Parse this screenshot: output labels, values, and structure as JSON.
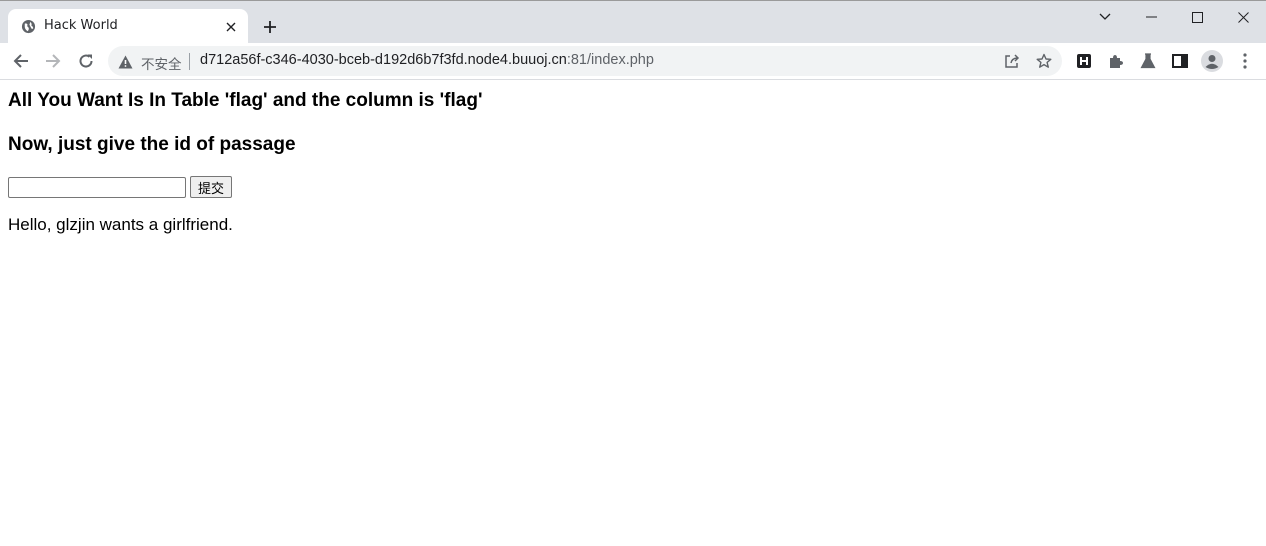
{
  "browser": {
    "tab": {
      "title": "Hack World",
      "favicon": "globe-icon"
    },
    "window_controls": [
      "chevron-down-icon",
      "minimize-icon",
      "maximize-icon",
      "close-icon"
    ],
    "address_bar": {
      "security_label": "不安全",
      "url_host": "d712a56f-c346-4030-bceb-d192d6b7f3fd.node4.buuoj.cn",
      "url_rest": ":81/index.php"
    },
    "toolbar_icons": [
      "share-icon",
      "bookmark-star-icon",
      "extension-h-icon",
      "puzzle-extensions-icon",
      "labs-flask-icon",
      "side-panel-icon",
      "profile-avatar-icon",
      "menu-kebab-icon"
    ]
  },
  "page": {
    "heading1": "All You Want Is In Table 'flag' and the column is 'flag'",
    "heading2": "Now, just give the id of passage",
    "form": {
      "input_value": "",
      "submit_label": "提交"
    },
    "result_text": "Hello, glzjin wants a girlfriend."
  }
}
